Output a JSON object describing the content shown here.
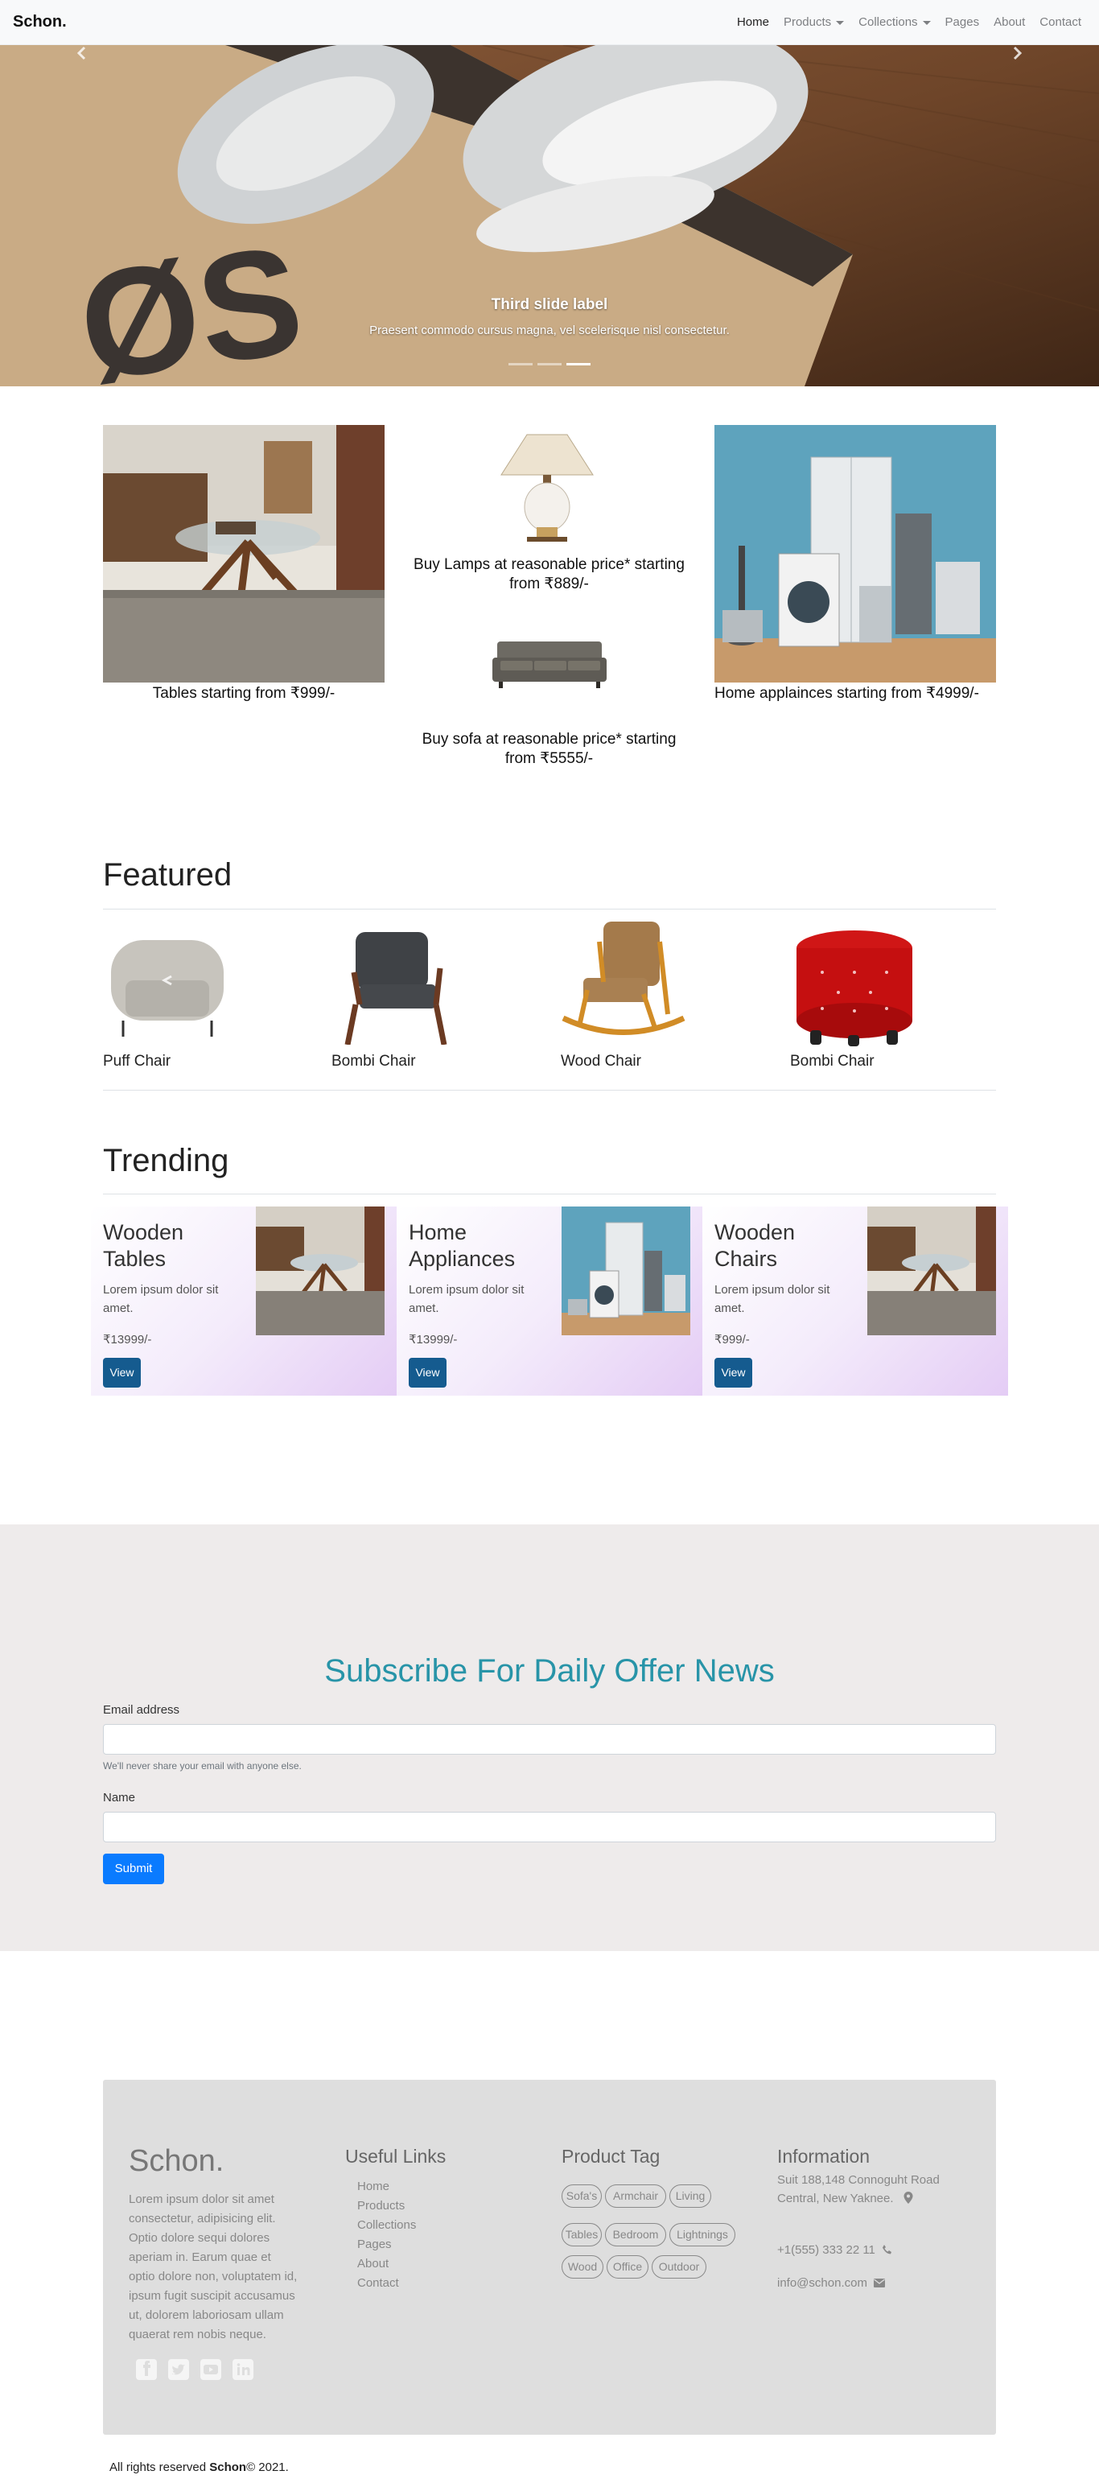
{
  "navbar": {
    "brand": "Schon.",
    "items": [
      {
        "label": "Home",
        "active": true,
        "dropdown": false
      },
      {
        "label": "Products",
        "active": false,
        "dropdown": true
      },
      {
        "label": "Collections",
        "active": false,
        "dropdown": true
      },
      {
        "label": "Pages",
        "active": false,
        "dropdown": false
      },
      {
        "label": "About",
        "active": false,
        "dropdown": false
      },
      {
        "label": "Contact",
        "active": false,
        "dropdown": false
      }
    ]
  },
  "hero": {
    "caption_title": "Third slide label",
    "caption_text": "Praesent commodo cursus magna, vel scelerisque nisl consectetur.",
    "slide_count": 3,
    "active_slide": 3,
    "prev_icon": "chevron-left-icon",
    "next_icon": "chevron-right-icon"
  },
  "categories": {
    "tables": "Tables starting from ₹999/-",
    "lamps": "Buy Lamps at reasonable price* starting from ₹889/-",
    "sofa": "Buy sofa at reasonable price* starting from ₹5555/-",
    "appliances": "Home applainces starting from ₹4999/-"
  },
  "featured": {
    "title": "Featured",
    "items": [
      "Puff Chair",
      "Bombi Chair",
      "Wood Chair",
      "Bombi Chair"
    ]
  },
  "trending": {
    "title": "Trending",
    "cards": [
      {
        "title": "Wooden Tables",
        "text": "Lorem ipsum dolor sit amet.",
        "price": "₹13999/-",
        "button": "View"
      },
      {
        "title": "Home Appliances",
        "text": "Lorem ipsum dolor sit amet.",
        "price": "₹13999/-",
        "button": "View"
      },
      {
        "title": "Wooden Chairs",
        "text": "Lorem ipsum dolor sit amet.",
        "price": "₹999/-",
        "button": "View"
      }
    ]
  },
  "subscribe": {
    "title": "Subscribe For Daily Offer News",
    "email_label": "Email address",
    "email_value": "",
    "email_help": "We'll never share your email with anyone else.",
    "name_label": "Name",
    "name_value": "",
    "submit": "Submit"
  },
  "footer": {
    "brand": "Schon.",
    "description": "Lorem ipsum dolor sit amet consectetur, adipisicing elit. Optio dolore sequi dolores aperiam in. Earum quae et optio dolore non, voluptatem id, ipsum fugit suscipit accusamus ut, dolorem laboriosam ullam quaerat rem nobis neque.",
    "useful_links_title": "Useful Links",
    "useful_links": [
      "Home",
      "Products",
      "Collections",
      "Pages",
      "About",
      "Contact"
    ],
    "tags_title": "Product Tag",
    "tags": [
      "Sofa's",
      "Armchair",
      "Living",
      "Tables",
      "Bedroom",
      "Lightnings",
      "Wood",
      "Office",
      "Outdoor"
    ],
    "info_title": "Information",
    "address": "Suit 188,148 Connoguht Road Central, New Yaknee.",
    "phone": "+1(555) 333 22 11",
    "email": "info@schon.com",
    "social_icons": [
      "facebook-icon",
      "twitter-icon",
      "youtube-icon",
      "linkedin-icon"
    ]
  },
  "copyright": {
    "prefix": "All rights reserved ",
    "brand": "Schon",
    "suffix": "© 2021."
  }
}
